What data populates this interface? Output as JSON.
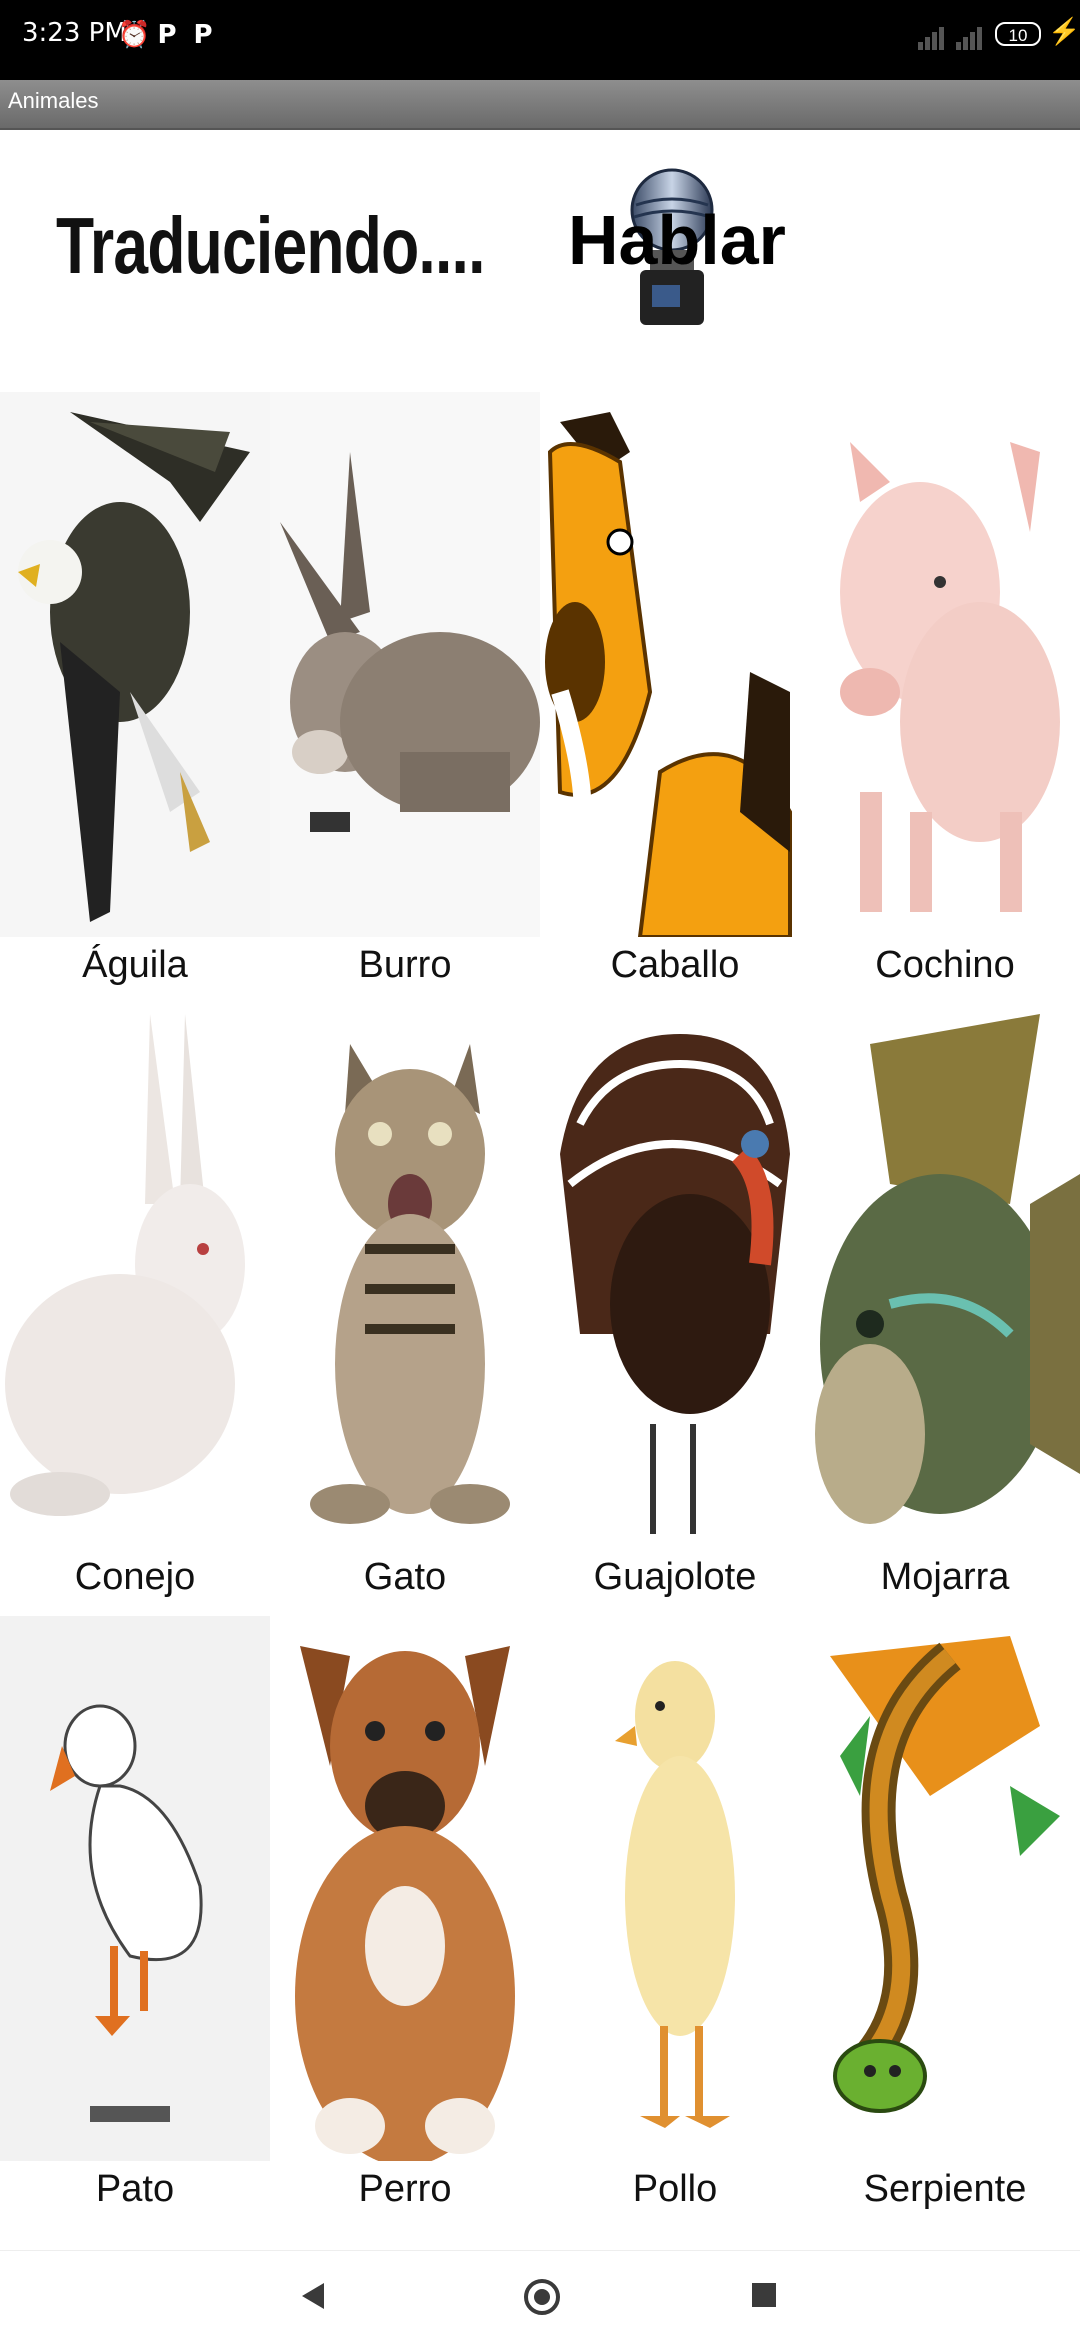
{
  "status_bar": {
    "time": "3:23 PM",
    "battery": "10",
    "icons": [
      "alarm-icon",
      "p-icon",
      "p-icon",
      "signal-icon",
      "signal-icon",
      "charging-icon"
    ]
  },
  "title_bar": {
    "title": "Animales"
  },
  "header": {
    "status_text": "Traduciendo....",
    "speak_label": "Hablar"
  },
  "animals": [
    {
      "name": "Águila"
    },
    {
      "name": "Burro"
    },
    {
      "name": "Caballo"
    },
    {
      "name": "Cochino"
    },
    {
      "name": "Conejo"
    },
    {
      "name": "Gato"
    },
    {
      "name": "Guajolote"
    },
    {
      "name": "Mojarra"
    },
    {
      "name": "Pato"
    },
    {
      "name": "Perro"
    },
    {
      "name": "Pollo"
    },
    {
      "name": "Serpiente"
    }
  ],
  "nav_bar": {
    "icons": [
      "back-icon",
      "home-icon",
      "recents-icon"
    ]
  }
}
